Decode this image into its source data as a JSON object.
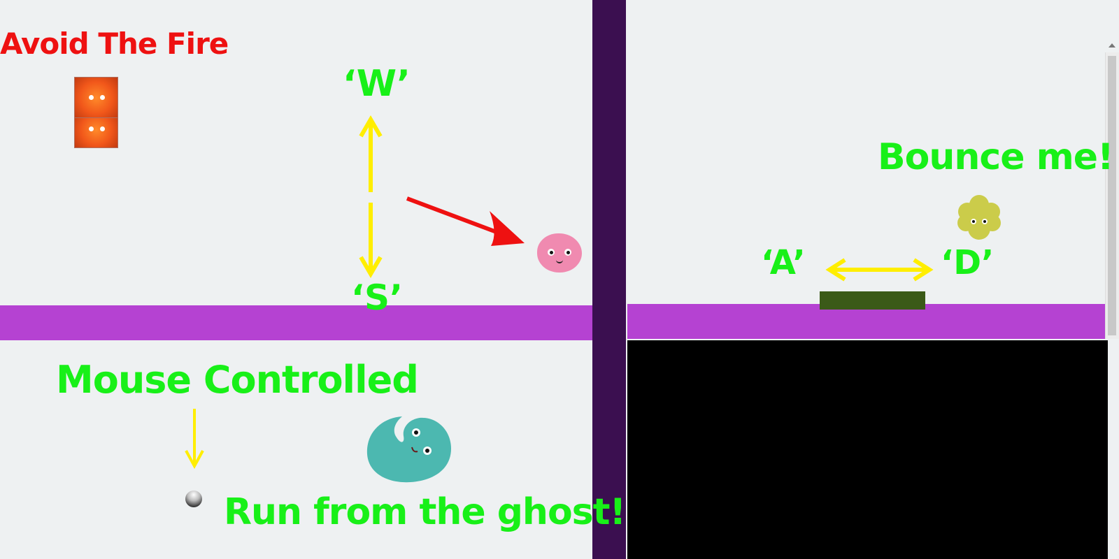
{
  "game1": {
    "title": "Avoid The Fire",
    "key_up": "‘W’",
    "key_down": "‘S’"
  },
  "game2": {
    "title": "Mouse Controlled",
    "caption": "Run from the ghost!"
  },
  "game3": {
    "caption": "Bounce me!",
    "key_left": "‘A’",
    "key_right": "‘D’"
  },
  "colors": {
    "background": "#eef1f2",
    "floor": "#b542d2",
    "divider": "#3b0f50",
    "text_green": "#18f018",
    "text_red": "#ee1111",
    "arrow_yellow": "#ffee00",
    "paddle": "#3b5a18",
    "black_panel": "#000000"
  },
  "icons": {
    "fire": "fire-sun-sprite",
    "player": "pink-blob-sprite",
    "ghost": "teal-ghost-sprite",
    "ball": "grey-ball",
    "bouncer": "yellow-cloud-sprite"
  }
}
